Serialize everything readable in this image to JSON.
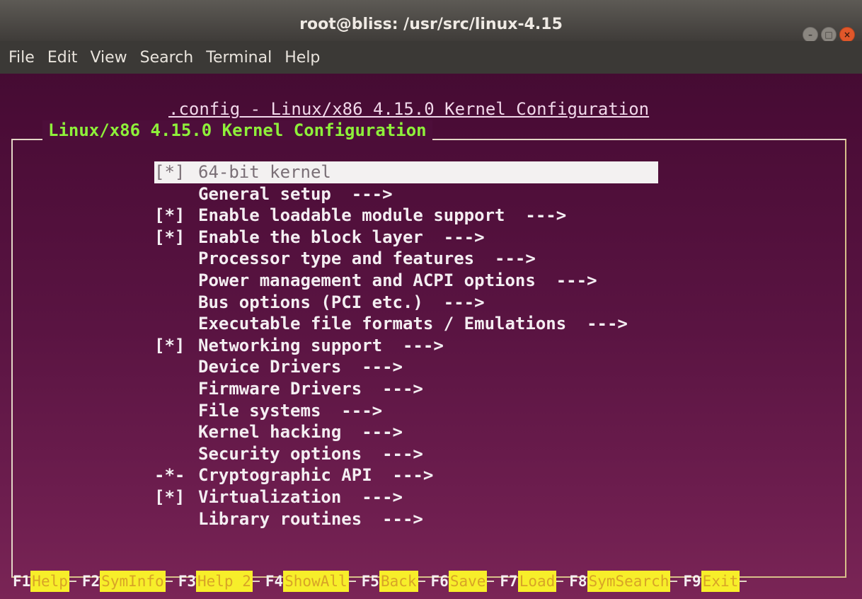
{
  "window": {
    "title": "root@bliss: /usr/src/linux-4.15",
    "controls": [
      "minimize",
      "maximize",
      "close"
    ]
  },
  "menubar": {
    "items": [
      {
        "label": "File"
      },
      {
        "label": "Edit"
      },
      {
        "label": "View"
      },
      {
        "label": "Search"
      },
      {
        "label": "Terminal"
      },
      {
        "label": "Help"
      }
    ]
  },
  "terminal": {
    "config_title": ".config - Linux/x86 4.15.0 Kernel Configuration",
    "frame_title": "Linux/x86 4.15.0 Kernel Configuration",
    "items": [
      {
        "mark": "[*]",
        "label": "64-bit kernel",
        "selected": true
      },
      {
        "mark": "",
        "label": "General setup  --->"
      },
      {
        "mark": "[*]",
        "label": "Enable loadable module support  --->"
      },
      {
        "mark": "[*]",
        "label": "Enable the block layer  --->"
      },
      {
        "mark": "",
        "label": "Processor type and features  --->"
      },
      {
        "mark": "",
        "label": "Power management and ACPI options  --->"
      },
      {
        "mark": "",
        "label": "Bus options (PCI etc.)  --->"
      },
      {
        "mark": "",
        "label": "Executable file formats / Emulations  --->"
      },
      {
        "mark": "[*]",
        "label": "Networking support  --->"
      },
      {
        "mark": "",
        "label": "Device Drivers  --->"
      },
      {
        "mark": "",
        "label": "Firmware Drivers  --->"
      },
      {
        "mark": "",
        "label": "File systems  --->"
      },
      {
        "mark": "",
        "label": "Kernel hacking  --->"
      },
      {
        "mark": "",
        "label": "Security options  --->"
      },
      {
        "mark": "-*-",
        "label": "Cryptographic API  --->"
      },
      {
        "mark": "[*]",
        "label": "Virtualization  --->"
      },
      {
        "mark": "",
        "label": "Library routines  --->"
      }
    ],
    "function_keys": [
      {
        "key": "F1",
        "label": "Help"
      },
      {
        "key": "F2",
        "label": "SymInfo"
      },
      {
        "key": "F3",
        "label": "Help 2"
      },
      {
        "key": "F4",
        "label": "ShowAll"
      },
      {
        "key": "F5",
        "label": "Back"
      },
      {
        "key": "F6",
        "label": "Save"
      },
      {
        "key": "F7",
        "label": "Load"
      },
      {
        "key": "F8",
        "label": "SymSearch"
      },
      {
        "key": "F9",
        "label": "Exit"
      }
    ]
  },
  "colors": {
    "background": "#5a1442",
    "frame_title": "#8ef03a",
    "fkey_label_bg": "#f7ee2a",
    "selection_bg": "#f3f1f1"
  }
}
